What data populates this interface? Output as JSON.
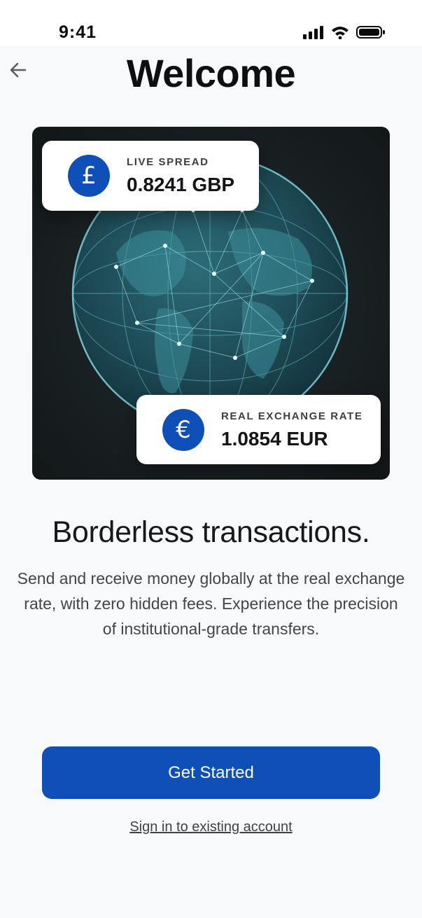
{
  "status_bar": {
    "time": "9:41"
  },
  "header": {
    "title": "Welcome"
  },
  "hero": {
    "cards": [
      {
        "currency_symbol": "£",
        "label": "LIVE SPREAD",
        "value": "0.8241 GBP"
      },
      {
        "currency_symbol": "€",
        "label": "REAL EXCHANGE RATE",
        "value": "1.0854 EUR"
      }
    ]
  },
  "content": {
    "headline": "Borderless transactions.",
    "description_lines": [
      "Send and receive money globally at the real exchange",
      "rate, with zero hidden fees. Experience the precision",
      "of institutional-grade transfers."
    ]
  },
  "actions": {
    "primary_label": "Get Started",
    "secondary_label": "Sign in to existing account"
  },
  "colors": {
    "accent": "#0e4fb8",
    "background": "#f8f9fa",
    "hero_bg": "#1b2326",
    "globe_glow": "#7fdde8"
  },
  "icons": {
    "back": "arrow-left-icon",
    "signal": "signal-icon",
    "wifi": "wifi-icon",
    "battery": "battery-icon"
  }
}
